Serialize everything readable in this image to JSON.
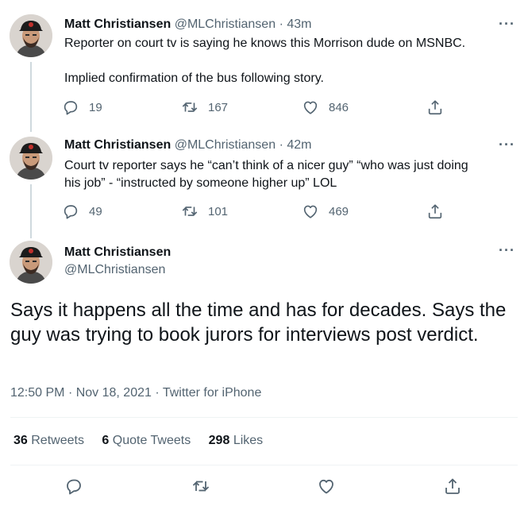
{
  "tweets": [
    {
      "name": "Matt Christiansen",
      "handle": "@MLChristiansen",
      "sep": "·",
      "time": "43m",
      "lines": [
        "Reporter on court tv is saying he knows this Morrison dude on MSNBC.",
        "",
        "Implied confirmation of the bus following story."
      ],
      "replies": "19",
      "retweets": "167",
      "likes": "846"
    },
    {
      "name": "Matt Christiansen",
      "handle": "@MLChristiansen",
      "sep": "·",
      "time": "42m",
      "lines": [
        "Court tv reporter says he “can’t think of a nicer guy” “who was just doing",
        "his job” - “instructed by someone higher up” LOL"
      ],
      "replies": "49",
      "retweets": "101",
      "likes": "469"
    }
  ],
  "main": {
    "name": "Matt Christiansen",
    "handle": "@MLChristiansen",
    "text": "Says it happens all the time and has for decades. Says the guy was trying to book jurors for interviews post verdict.",
    "time": "12:50 PM",
    "date": "Nov 18, 2021",
    "sep": "·",
    "source": "Twitter for iPhone",
    "retweets_count": "36",
    "retweets_label": "Retweets",
    "quotes_count": "6",
    "quotes_label": "Quote Tweets",
    "likes_count": "298",
    "likes_label": "Likes"
  },
  "more_glyph": "···",
  "icons": [
    "reply-icon",
    "retweet-icon",
    "like-icon",
    "share-icon"
  ],
  "colors": {
    "text": "#0f1419",
    "secondary": "#536471",
    "divider": "#eff3f4",
    "thread_line": "#cfd9de"
  }
}
